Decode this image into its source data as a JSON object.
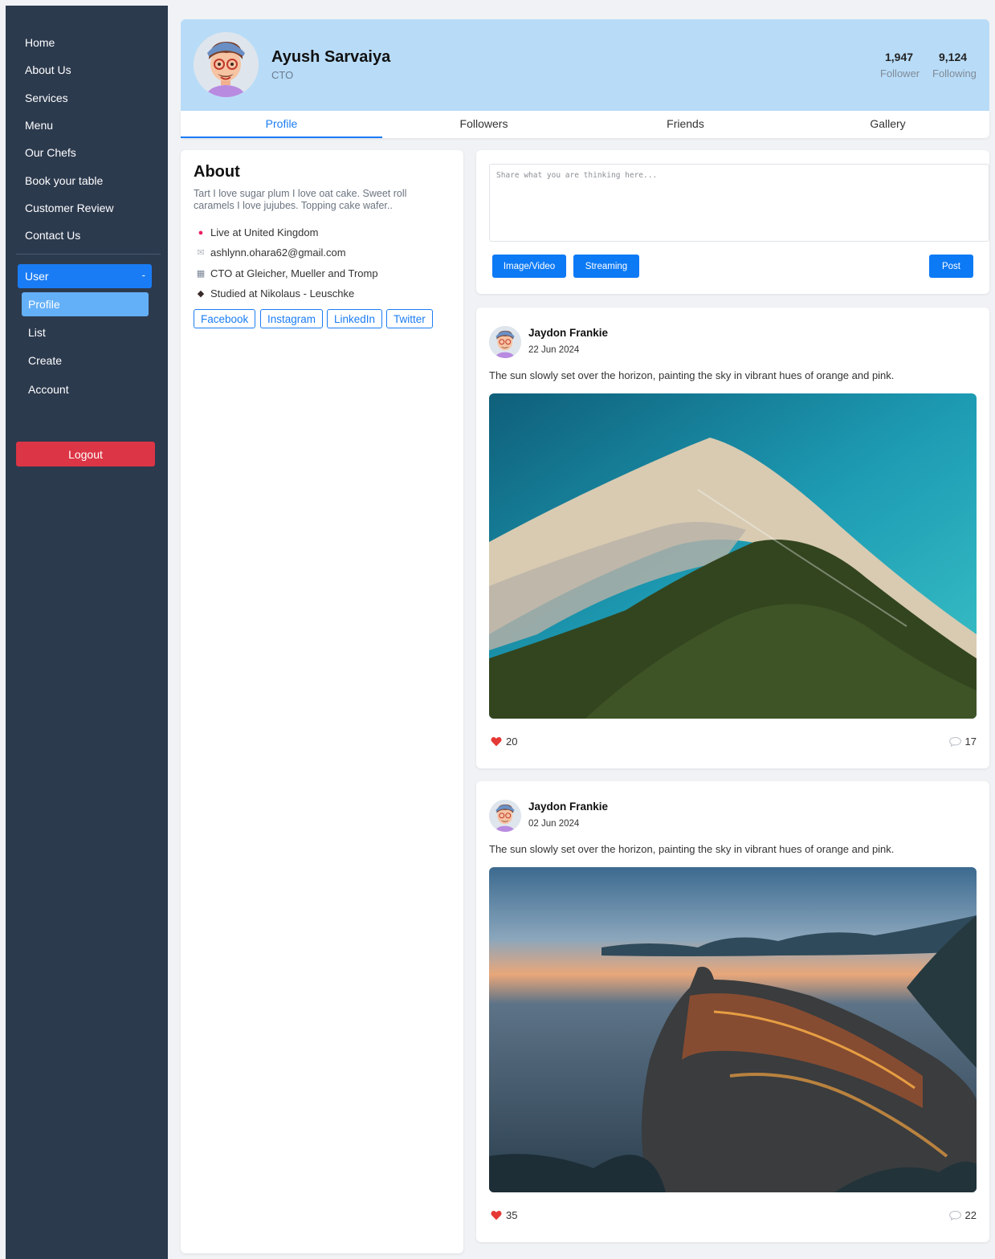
{
  "sidebar": {
    "nav": [
      "Home",
      "About Us",
      "Services",
      "Menu",
      "Our Chefs",
      "Book your table",
      "Customer Review",
      "Contact Us"
    ],
    "user_label": "User",
    "user_toggle": "-",
    "sub": [
      "Profile",
      "List",
      "Create",
      "Account"
    ],
    "logout": "Logout"
  },
  "profile": {
    "name": "Ayush Sarvaiya",
    "role": "CTO",
    "followers_count": "1,947",
    "followers_label": "Follower",
    "following_count": "9,124",
    "following_label": "Following"
  },
  "tabs": [
    "Profile",
    "Followers",
    "Friends",
    "Gallery"
  ],
  "about": {
    "title": "About",
    "bio": "Tart I love sugar plum I love oat cake. Sweet roll caramels I love jujubes. Topping cake wafer..",
    "info": [
      {
        "icon": "location-pin-icon",
        "text": "Live at United Kingdom"
      },
      {
        "icon": "envelope-icon",
        "text": "ashlynn.ohara62@gmail.com"
      },
      {
        "icon": "building-icon",
        "text": "CTO at Gleicher, Mueller and Tromp"
      },
      {
        "icon": "graduation-cap-icon",
        "text": "Studied at Nikolaus - Leuschke"
      }
    ],
    "social": [
      "Facebook",
      "Instagram",
      "LinkedIn",
      "Twitter"
    ]
  },
  "composer": {
    "placeholder": "Share what you are thinking here...",
    "image_video": "Image/Video",
    "streaming": "Streaming",
    "post": "Post"
  },
  "posts": [
    {
      "author": "Jaydon Frankie",
      "date": "22 Jun 2024",
      "text": "The sun slowly set over the horizon, painting the sky in vibrant hues of orange and pink.",
      "likes": "20",
      "comments": "17",
      "image": "beach-aerial-photo"
    },
    {
      "author": "Jaydon Frankie",
      "date": "02 Jun 2024",
      "text": "The sun slowly set over the horizon, painting the sky in vibrant hues of orange and pink.",
      "likes": "35",
      "comments": "22",
      "image": "coastal-village-sunset-photo"
    }
  ],
  "colors": {
    "sidebar": "#2c3a4e",
    "accent": "#1a7cf5",
    "header": "#b8dcf8",
    "danger": "#dc3545",
    "like": "#e53935"
  }
}
